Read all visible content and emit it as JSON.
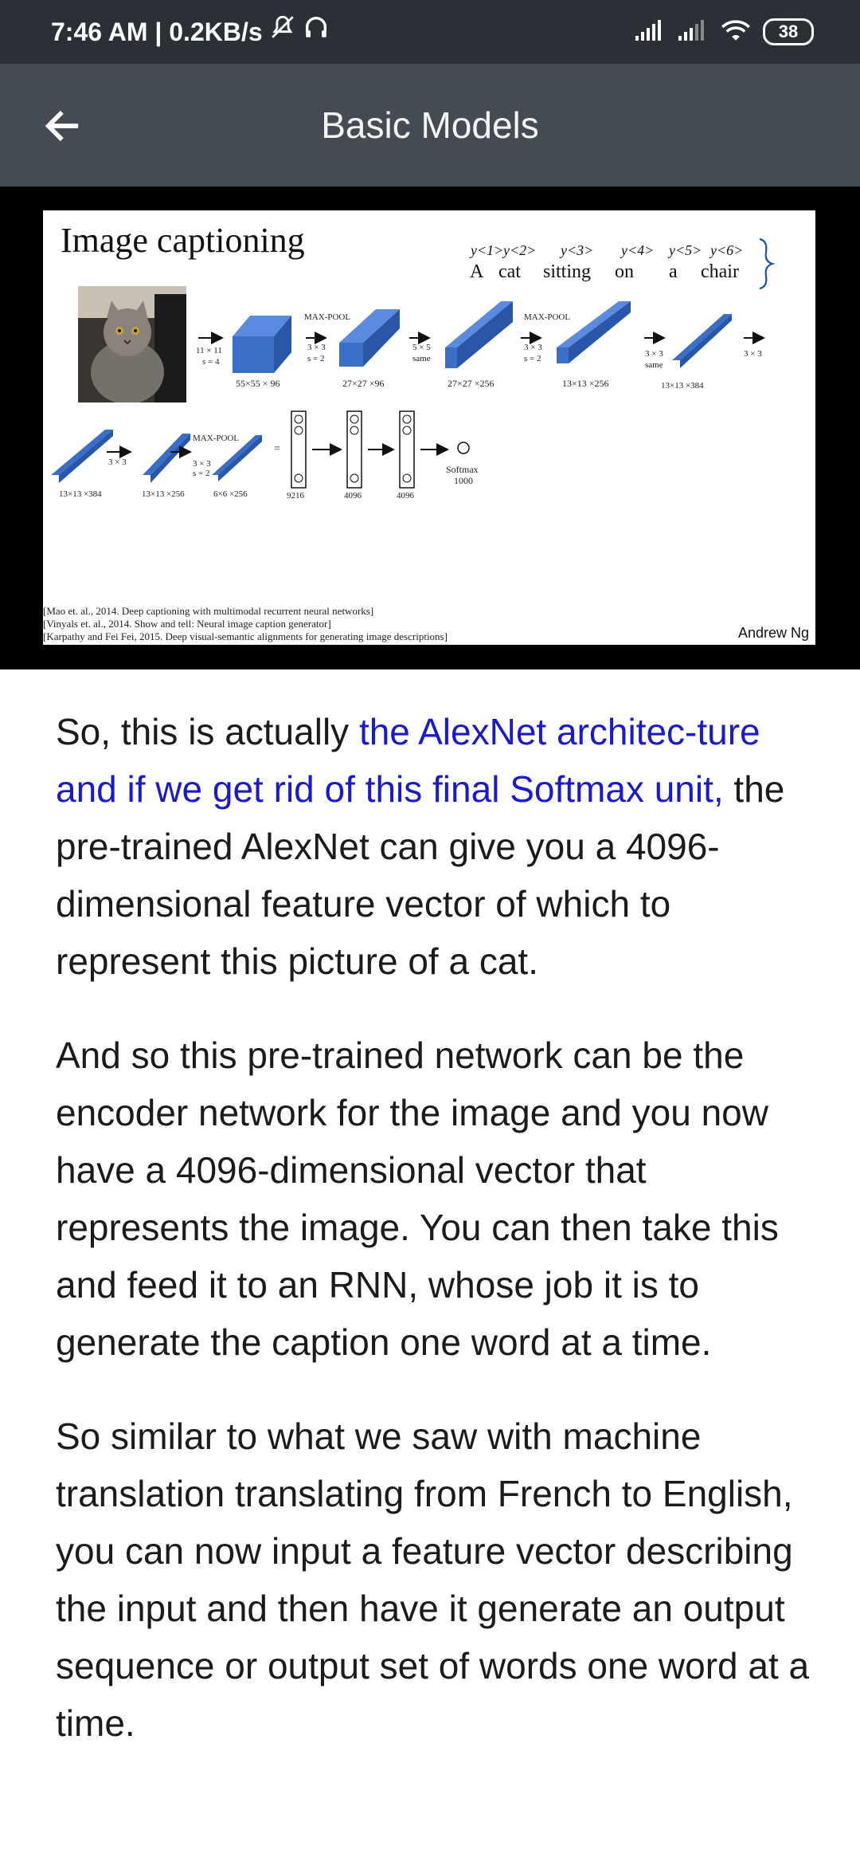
{
  "status": {
    "time_speed": "7:46 AM | 0.2KB/s",
    "battery": "38"
  },
  "app_bar": {
    "title": "Basic Models"
  },
  "slide": {
    "title": "Image captioning",
    "caption_words": [
      "A",
      "cat",
      "sitting",
      "on",
      "a",
      "chair"
    ],
    "caption_ys": [
      "y<1>",
      "y<2>",
      "y<3>",
      "y<4>",
      "y<5>",
      "y<6>"
    ],
    "row1_labels": {
      "max_pool_1": "MAX-POOL",
      "max_pool_2": "MAX-POOL",
      "conv1": "11 × 11",
      "s4": "s = 4",
      "k33a": "3 × 3",
      "s2a": "s = 2",
      "k55": "5 × 5",
      "same1": "same",
      "k33b": "3 × 3",
      "s2b": "s = 2",
      "k33c": "3 × 3",
      "same2": "same",
      "k33d": "3 × 3",
      "d1": "55×55 × 96",
      "d2": "27×27 ×96",
      "d3": "27×27 ×256",
      "d4": "13×13 ×256",
      "d5": "13×13 ×384"
    },
    "row2_labels": {
      "d6": "13×13 ×384",
      "k33e": "3 × 3",
      "d7": "13×13 ×256",
      "max_pool_3": "MAX-POOL",
      "k33f": "3 × 3",
      "s2c": "s = 2",
      "d8": "6×6 ×256",
      "eq": "=",
      "fc1": "9216",
      "fc2": "4096",
      "fc3": "4096",
      "softmax": "Softmax",
      "softmax_n": "1000"
    },
    "refs": [
      "[Mao et. al., 2014. Deep captioning with multimodal recurrent neural networks]",
      "[Vinyals et. al., 2014. Show and tell: Neural image caption generator]",
      "[Karpathy and Fei Fei, 2015. Deep visual-semantic alignments for generating image descriptions]"
    ],
    "author": "Andrew Ng"
  },
  "paragraphs": {
    "p1_start": "So, this is actually ",
    "p1_highlight": "the AlexNet architec-ture and if we get rid of this final Softmax unit,",
    "p1_end": " the pre-trained AlexNet can give you a 4096-dimensional feature vector of which to represent this picture of a cat.",
    "p2": "And so this pre-trained network can be the encoder network for the image and you now have a 4096-dimensional vector that represents the image. You can then take this and feed it to an RNN, whose job it is to generate the caption one word at a time.",
    "p3": "So similar to what we saw with machine translation translating from French to English, you can now input a feature vector describing the input and then have it generate an output sequence or output set of words one word at a time."
  },
  "colors": {
    "status_bar": "#2b3036",
    "app_bar": "#454b53",
    "highlight": "#1a1acc",
    "block_blue": "#3a6fc8"
  }
}
